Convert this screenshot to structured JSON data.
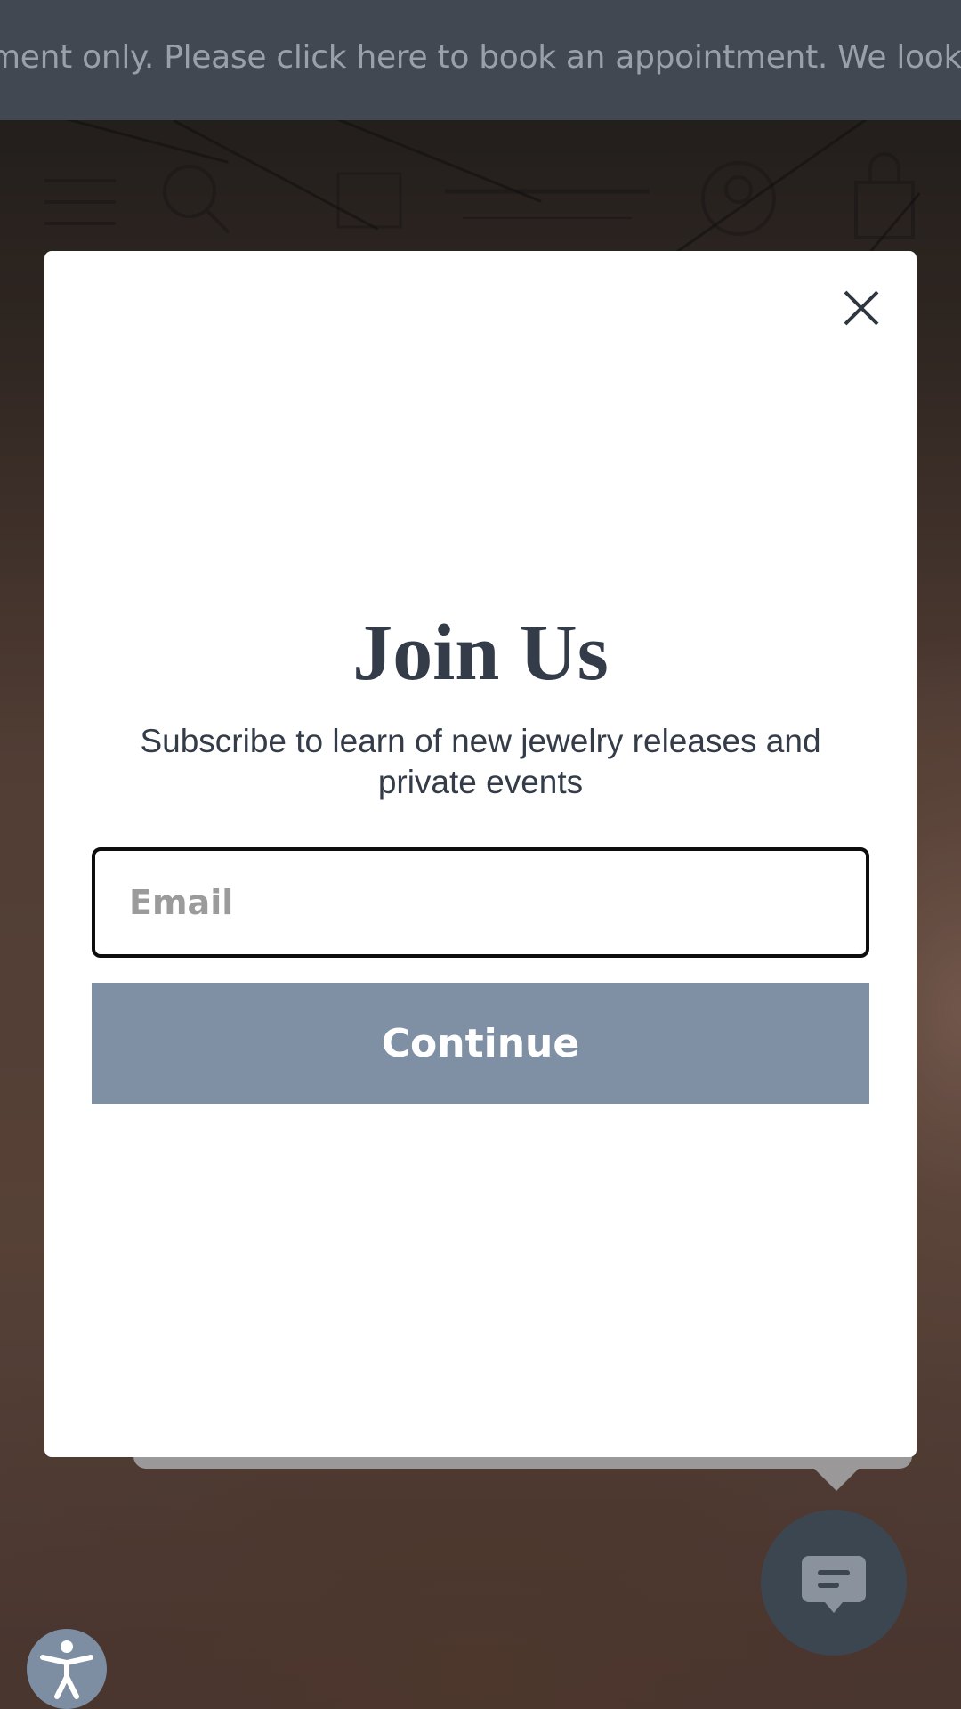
{
  "announcement": {
    "text": "ment only. Please click here to book an appointment. We look forward"
  },
  "header": {
    "menu_icon": "hamburger-menu-icon",
    "search_icon": "search-icon",
    "logo_icon": "brand-logo",
    "account_icon": "user-account-icon",
    "cart_icon": "shopping-bag-icon"
  },
  "modal": {
    "close_icon": "close-icon",
    "title": "Join Us",
    "subtitle": "Subscribe to learn of new jewelry releases and private events",
    "email_placeholder": "Email",
    "email_value": "",
    "continue_label": "Continue"
  },
  "widgets": {
    "chat_icon": "chat-bubble-icon",
    "accessibility_icon": "accessibility-icon"
  },
  "colors": {
    "announcement_bg": "#414852",
    "title_text": "#333c48",
    "button_bg": "#8090a4",
    "chat_bg": "#3c4650",
    "accessibility_bg": "#7e8ea2"
  }
}
